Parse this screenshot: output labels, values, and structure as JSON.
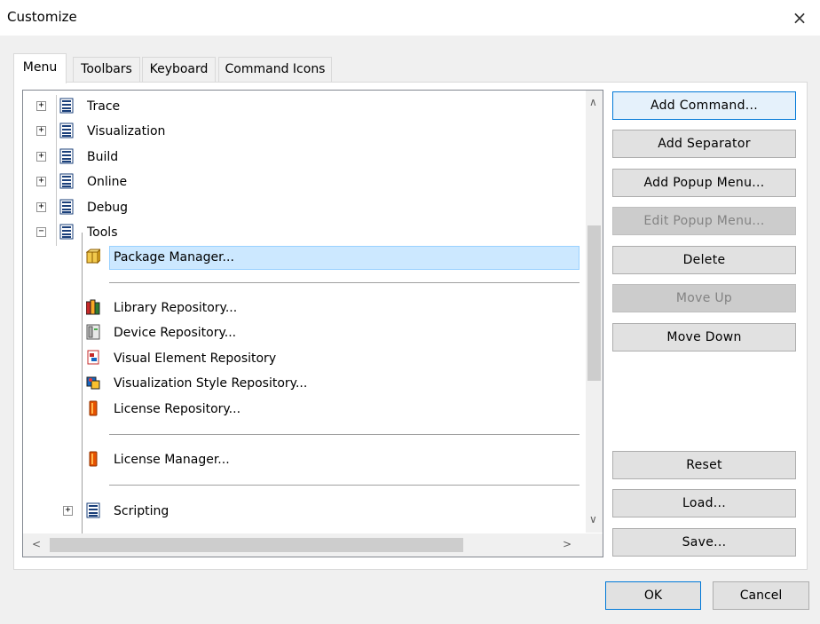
{
  "window": {
    "title": "Customize",
    "close_glyph": "×"
  },
  "tabs": [
    {
      "label": "Menu",
      "active": true
    },
    {
      "label": "Toolbars",
      "active": false
    },
    {
      "label": "Keyboard",
      "active": false
    },
    {
      "label": "Command Icons",
      "active": false
    }
  ],
  "tree": {
    "top_items": [
      {
        "label": "Trace",
        "expander": "+"
      },
      {
        "label": "Visualization",
        "expander": "+"
      },
      {
        "label": "Build",
        "expander": "+"
      },
      {
        "label": "Online",
        "expander": "+"
      },
      {
        "label": "Debug",
        "expander": "+"
      },
      {
        "label": "Tools",
        "expander": "−"
      }
    ],
    "tools_children": [
      {
        "label": "Package Manager...",
        "icon": "package-icon",
        "selected": true
      },
      {
        "label": "Library Repository...",
        "icon": "library-icon"
      },
      {
        "label": "Device Repository...",
        "icon": "device-icon"
      },
      {
        "label": "Visual Element Repository",
        "icon": "visual-element-icon"
      },
      {
        "label": "Visualization Style Repository...",
        "icon": "visualization-style-icon"
      },
      {
        "label": "License Repository...",
        "icon": "license-icon"
      },
      {
        "label": "License Manager...",
        "icon": "license-icon"
      },
      {
        "label": "Scripting",
        "icon": "menu-icon",
        "expander": "+"
      }
    ]
  },
  "buttons": {
    "add_command": "Add Command...",
    "add_separator": "Add Separator",
    "add_popup_menu": "Add Popup Menu...",
    "edit_popup_menu": "Edit Popup Menu...",
    "delete": "Delete",
    "move_up": "Move Up",
    "move_down": "Move Down",
    "reset": "Reset",
    "load": "Load...",
    "save": "Save...",
    "ok": "OK",
    "cancel": "Cancel"
  },
  "colors": {
    "selection": "#cce8ff",
    "default_button_border": "#0078d7"
  }
}
